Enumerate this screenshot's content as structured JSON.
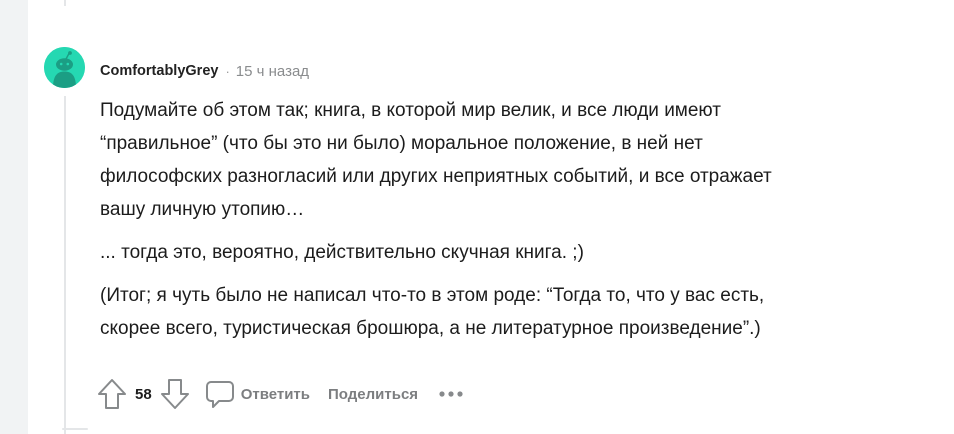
{
  "comment": {
    "username": "ComfortablyGrey",
    "separator": "·",
    "timestamp": "15 ч назад",
    "avatar": {
      "icon": "snoo-avatar-icon",
      "background_color": "#25d8b2",
      "figure_color": "#1b9e84"
    },
    "paragraphs": [
      {
        "lines": [
          "Подумайте об этом так; книга, в которой мир велик, и все люди имеют",
          "“правильное” (что бы это ни было) моральное положение, в ней нет",
          "философских разногласий или других неприятных событий, и все отражает",
          "вашу личную утопию…"
        ]
      },
      {
        "lines": [
          "... тогда это, вероятно, действительно скучная книга. ;)"
        ]
      },
      {
        "lines": [
          "(Итог; я чуть было не написал что-то в этом роде: “Тогда то, что у вас есть,",
          "скорее всего, туристическая брошюра, а не литературное произведение”.)"
        ]
      }
    ]
  },
  "actions": {
    "upvote_icon": "arrow-up-icon",
    "score": "58",
    "downvote_icon": "arrow-down-icon",
    "reply_icon": "speech-bubble-icon",
    "reply_label": "Ответить",
    "share_label": "Поделиться",
    "more_icon": "ellipsis-icon"
  },
  "colors": {
    "text": "#1c1c1c",
    "muted": "#8a8c8e",
    "action_label": "#7c7e80",
    "icon_stroke": "#878a8c",
    "thread_line": "#e4e6e8"
  }
}
